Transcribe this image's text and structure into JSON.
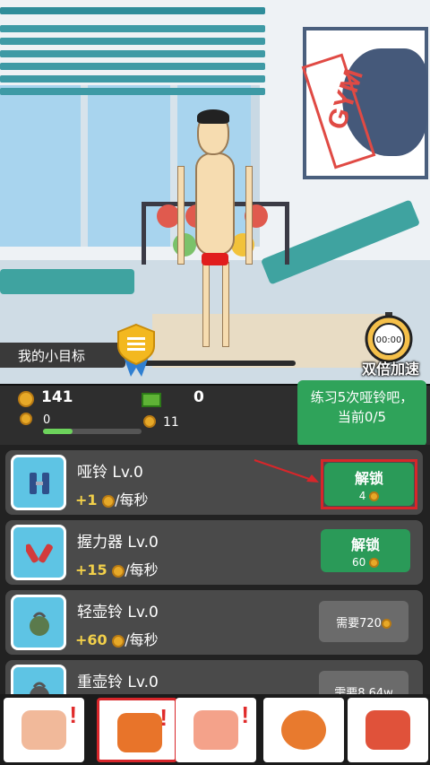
{
  "poster": {
    "text": "GYM"
  },
  "goal": {
    "label": "我的小目标"
  },
  "boost": {
    "timer": "00:00",
    "label": "双倍加速"
  },
  "stats": {
    "coins": "141",
    "cash": "0",
    "coin_rate": "0",
    "cash_rate": "11",
    "xp_progress_fraction": 0.3
  },
  "tooltip": {
    "line1": "练习5次哑铃吧，",
    "line2": "当前0/5"
  },
  "equipment": [
    {
      "name": "哑铃  Lv.0",
      "rate": "+1",
      "unit": "/每秒",
      "action": "解锁",
      "cost": "4"
    },
    {
      "name": "握力器  Lv.0",
      "rate": "+15",
      "unit": "/每秒",
      "action": "解锁",
      "cost": "60"
    },
    {
      "name": "轻壶铃  Lv.0",
      "rate": "+60",
      "unit": "/每秒",
      "action": "需要720"
    },
    {
      "name": "重壶铃  Lv.0",
      "rate": "",
      "unit": "",
      "action": "需要8.64w"
    }
  ],
  "nav": {
    "tabs": [
      "workout-tab",
      "equipment-tab",
      "muscle-tab",
      "sports-tab",
      "outfit-tab"
    ],
    "badge": "!"
  },
  "colors": {
    "green_button": "#2a9a58",
    "highlight_red": "#d8262a",
    "coin_gold": "#e7a928"
  }
}
